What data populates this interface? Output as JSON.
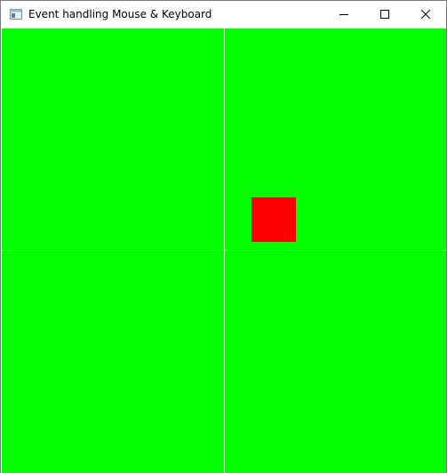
{
  "window": {
    "title": "Event handling Mouse & Keyboard"
  },
  "icons": {
    "app": "app-window-icon",
    "minimize": "minimize-icon",
    "maximize": "maximize-icon",
    "close": "close-icon"
  },
  "colors": {
    "canvas_background": "#00ff00",
    "grid_line": "#c8ffc8",
    "square": "#ff0000"
  },
  "scene": {
    "grid": "2x2",
    "square_quadrant": "top-right"
  }
}
